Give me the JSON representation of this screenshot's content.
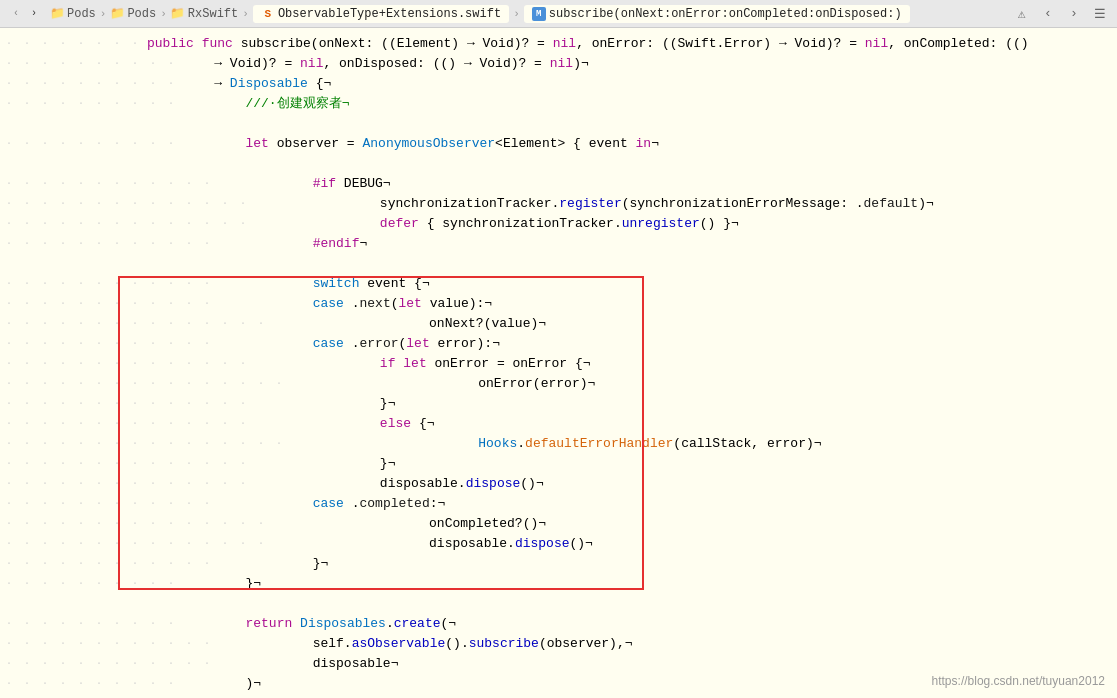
{
  "titlebar": {
    "breadcrumbs": [
      {
        "label": "Pods",
        "type": "folder"
      },
      {
        "label": "Pods",
        "type": "folder"
      },
      {
        "label": "RxSwift",
        "type": "folder"
      },
      {
        "label": "ObservableType+Extensions.swift",
        "type": "swift-file"
      },
      {
        "label": "subscribe(onNext:onError:onCompleted:onDisposed:)",
        "type": "method"
      }
    ]
  },
  "watermark": "https://blog.csdn.net/tuyuan2012",
  "code": {
    "lines": [
      {
        "dots": "· · · · · · · ·",
        "content": "public func subscribe(onNext: ((Element) → Void)? = nil, onError: ((Swift.Error) → Void)? = nil, onCompleted: (()",
        "tokens": [
          {
            "text": "public ",
            "cls": "kw"
          },
          {
            "text": "func ",
            "cls": "kw"
          },
          {
            "text": "subscribe",
            "cls": "plain"
          },
          {
            "text": "(onNext: ((Element) → Void)? = ",
            "cls": "plain"
          },
          {
            "text": "nil",
            "cls": "nil-kw"
          },
          {
            "text": ", onError: ((Swift.Error) → Void)? = ",
            "cls": "plain"
          },
          {
            "text": "nil",
            "cls": "nil-kw"
          },
          {
            "text": ", onCompleted: (()",
            "cls": "plain"
          }
        ]
      },
      {
        "dots": "· · · · · · · · · ·",
        "content": "    → Void)? = nil, onDisposed: (() → Void)? = nil)¬",
        "tokens": [
          {
            "text": "    → Void)? = ",
            "cls": "plain"
          },
          {
            "text": "nil",
            "cls": "nil-kw"
          },
          {
            "text": ", onDisposed: (() → Void)? = ",
            "cls": "plain"
          },
          {
            "text": "nil",
            "cls": "nil-kw"
          },
          {
            "text": ")¬",
            "cls": "plain"
          }
        ]
      },
      {
        "dots": "· · · · · · · · · ·",
        "content": "    → Disposable {¬",
        "tokens": [
          {
            "text": "    → ",
            "cls": "plain"
          },
          {
            "text": "Disposable",
            "cls": "type"
          },
          {
            "text": " {¬",
            "cls": "plain"
          }
        ]
      },
      {
        "dots": "· · · · · · · · · ·",
        "content": "        ///·创建观察者¬",
        "tokens": [
          {
            "text": "        ///·创建观察者¬",
            "cls": "comment"
          }
        ]
      },
      {
        "dots": "",
        "content": ""
      },
      {
        "dots": "· · · · · · · · · ·",
        "content": "        let observer = AnonymousObserver<Element> { event in¬",
        "tokens": [
          {
            "text": "        ",
            "cls": "plain"
          },
          {
            "text": "let ",
            "cls": "kw"
          },
          {
            "text": "observer = ",
            "cls": "plain"
          },
          {
            "text": "AnonymousObserver",
            "cls": "type"
          },
          {
            "text": "<Element> { event ",
            "cls": "plain"
          },
          {
            "text": "in",
            "cls": "kw"
          },
          {
            "text": "¬",
            "cls": "plain"
          }
        ]
      },
      {
        "dots": "",
        "content": ""
      },
      {
        "dots": "· · · · · · · · · · · ·",
        "content": "            #if DEBUG¬",
        "tokens": [
          {
            "text": "            ",
            "cls": "plain"
          },
          {
            "text": "#if ",
            "cls": "kw"
          },
          {
            "text": "DEBUG¬",
            "cls": "plain"
          }
        ]
      },
      {
        "dots": "· · · · · · · · · · · · · ·",
        "content": "                synchronizationTracker.register(synchronizationErrorMessage: .default)¬",
        "tokens": [
          {
            "text": "                synchronizationTracker.",
            "cls": "plain"
          },
          {
            "text": "register",
            "cls": "method"
          },
          {
            "text": "(synchronizationErrorMessage: .",
            "cls": "plain"
          },
          {
            "text": "default",
            "cls": "plain"
          },
          {
            "text": ")¬",
            "cls": "plain"
          }
        ]
      },
      {
        "dots": "· · · · · · · · · · · · · ·",
        "content": "                defer { synchronizationTracker.unregister() }¬",
        "tokens": [
          {
            "text": "                ",
            "cls": "plain"
          },
          {
            "text": "defer",
            "cls": "kw"
          },
          {
            "text": " { synchronizationTracker.",
            "cls": "plain"
          },
          {
            "text": "unregister",
            "cls": "method"
          },
          {
            "text": "() }¬",
            "cls": "plain"
          }
        ]
      },
      {
        "dots": "· · · · · · · · · · · ·",
        "content": "            #endif¬",
        "tokens": [
          {
            "text": "            ",
            "cls": "plain"
          },
          {
            "text": "#endif",
            "cls": "kw"
          },
          {
            "text": "¬",
            "cls": "plain"
          }
        ]
      },
      {
        "dots": "",
        "content": ""
      },
      {
        "dots": "· · · · · · · · · · · ·",
        "content": "            switch event {¬",
        "tokens": [
          {
            "text": "            ",
            "cls": "plain"
          },
          {
            "text": "switch ",
            "cls": "kw-blue"
          },
          {
            "text": "event {¬",
            "cls": "plain"
          }
        ]
      },
      {
        "dots": "· · · · · · · · · · · ·",
        "content": "            case .next(let value):¬",
        "tokens": [
          {
            "text": "            ",
            "cls": "plain"
          },
          {
            "text": "case ",
            "cls": "kw-blue"
          },
          {
            "text": ".",
            "cls": "plain"
          },
          {
            "text": "next",
            "cls": "plain"
          },
          {
            "text": "(",
            "cls": "plain"
          },
          {
            "text": "let ",
            "cls": "kw"
          },
          {
            "text": "value):¬",
            "cls": "plain"
          }
        ]
      },
      {
        "dots": "· · · · · · · · · · · · · · ·",
        "content": "                    onNext?(value)¬",
        "tokens": [
          {
            "text": "                    onNext?(value)¬",
            "cls": "plain"
          }
        ]
      },
      {
        "dots": "· · · · · · · · · · · ·",
        "content": "            case .error(let error):¬",
        "tokens": [
          {
            "text": "            ",
            "cls": "plain"
          },
          {
            "text": "case ",
            "cls": "kw-blue"
          },
          {
            "text": ".",
            "cls": "plain"
          },
          {
            "text": "error",
            "cls": "plain"
          },
          {
            "text": "(",
            "cls": "plain"
          },
          {
            "text": "let ",
            "cls": "kw"
          },
          {
            "text": "error):¬",
            "cls": "plain"
          }
        ]
      },
      {
        "dots": "· · · · · · · · · · · · · ·",
        "content": "                if let onError = onError {¬",
        "tokens": [
          {
            "text": "                ",
            "cls": "plain"
          },
          {
            "text": "if ",
            "cls": "kw"
          },
          {
            "text": "let ",
            "cls": "kw"
          },
          {
            "text": "onError = onError {¬",
            "cls": "plain"
          }
        ]
      },
      {
        "dots": "· · · · · · · · · · · · · · · ·",
        "content": "                        onError(error)¬",
        "tokens": [
          {
            "text": "                        onError(error)¬",
            "cls": "plain"
          }
        ]
      },
      {
        "dots": "· · · · · · · · · · · · · ·",
        "content": "                }¬",
        "tokens": [
          {
            "text": "                }¬",
            "cls": "plain"
          }
        ]
      },
      {
        "dots": "· · · · · · · · · · · · · ·",
        "content": "                else {¬",
        "tokens": [
          {
            "text": "                ",
            "cls": "plain"
          },
          {
            "text": "else ",
            "cls": "kw"
          },
          {
            "text": "{¬",
            "cls": "plain"
          }
        ]
      },
      {
        "dots": "· · · · · · · · · · · · · · · ·",
        "content": "                        Hooks.defaultErrorHandler(callStack, error)¬",
        "tokens": [
          {
            "text": "                        ",
            "cls": "plain"
          },
          {
            "text": "Hooks",
            "cls": "type"
          },
          {
            "text": ".",
            "cls": "plain"
          },
          {
            "text": "defaultErrorHandler",
            "cls": "orange"
          },
          {
            "text": "(callStack, error)¬",
            "cls": "plain"
          }
        ]
      },
      {
        "dots": "· · · · · · · · · · · · · ·",
        "content": "                }¬",
        "tokens": [
          {
            "text": "                }¬",
            "cls": "plain"
          }
        ]
      },
      {
        "dots": "· · · · · · · · · · · · · ·",
        "content": "                disposable.dispose()¬",
        "tokens": [
          {
            "text": "                disposable.",
            "cls": "plain"
          },
          {
            "text": "dispose",
            "cls": "method"
          },
          {
            "text": "()¬",
            "cls": "plain"
          }
        ]
      },
      {
        "dots": "· · · · · · · · · · · ·",
        "content": "            case .completed:¬",
        "tokens": [
          {
            "text": "            ",
            "cls": "plain"
          },
          {
            "text": "case ",
            "cls": "kw-blue"
          },
          {
            "text": ".",
            "cls": "plain"
          },
          {
            "text": "completed",
            "cls": "plain"
          },
          {
            "text": ":¬",
            "cls": "plain"
          }
        ]
      },
      {
        "dots": "· · · · · · · · · · · · · · ·",
        "content": "                    onCompleted?()¬",
        "tokens": [
          {
            "text": "                    onCompleted?()¬",
            "cls": "plain"
          }
        ]
      },
      {
        "dots": "· · · · · · · · · · · · · · ·",
        "content": "                    disposable.dispose()¬",
        "tokens": [
          {
            "text": "                    disposable.",
            "cls": "plain"
          },
          {
            "text": "dispose",
            "cls": "method"
          },
          {
            "text": "()¬",
            "cls": "plain"
          }
        ]
      },
      {
        "dots": "· · · · · · · · · · · ·",
        "content": "            }¬",
        "tokens": [
          {
            "text": "            }¬",
            "cls": "plain"
          }
        ]
      },
      {
        "dots": "· · · · · · · · · ·",
        "content": "        }¬",
        "tokens": [
          {
            "text": "        }¬",
            "cls": "plain"
          }
        ]
      },
      {
        "dots": "",
        "content": ""
      },
      {
        "dots": "· · · · · · · · · ·",
        "content": "        return Disposables.create(¬",
        "tokens": [
          {
            "text": "        ",
            "cls": "plain"
          },
          {
            "text": "return ",
            "cls": "kw"
          },
          {
            "text": "Disposables",
            "cls": "type"
          },
          {
            "text": ".",
            "cls": "plain"
          },
          {
            "text": "create",
            "cls": "method"
          },
          {
            "text": "(¬",
            "cls": "plain"
          }
        ]
      },
      {
        "dots": "· · · · · · · · · · · ·",
        "content": "            self.asObservable().subscribe(observer),¬",
        "tokens": [
          {
            "text": "            self.",
            "cls": "plain"
          },
          {
            "text": "asObservable",
            "cls": "method"
          },
          {
            "text": "().",
            "cls": "plain"
          },
          {
            "text": "subscribe",
            "cls": "method"
          },
          {
            "text": "(observer),¬",
            "cls": "plain"
          }
        ]
      },
      {
        "dots": "· · · · · · · · · · · ·",
        "content": "            disposable¬",
        "tokens": [
          {
            "text": "            disposable¬",
            "cls": "plain"
          }
        ]
      },
      {
        "dots": "· · · · · · · · · ·",
        "content": "        )¬",
        "tokens": [
          {
            "text": "        )¬",
            "cls": "plain"
          }
        ]
      },
      {
        "dots": "",
        "content": ""
      },
      {
        "dots": "· · · · · ·",
        "content": "    }¬",
        "tokens": [
          {
            "text": "    }¬",
            "cls": "plain"
          }
        ]
      },
      {
        "dots": "",
        "content": ""
      },
      {
        "dots": "· ·",
        "content": "}¬",
        "tokens": [
          {
            "text": "}¬",
            "cls": "plain"
          }
        ]
      }
    ]
  }
}
